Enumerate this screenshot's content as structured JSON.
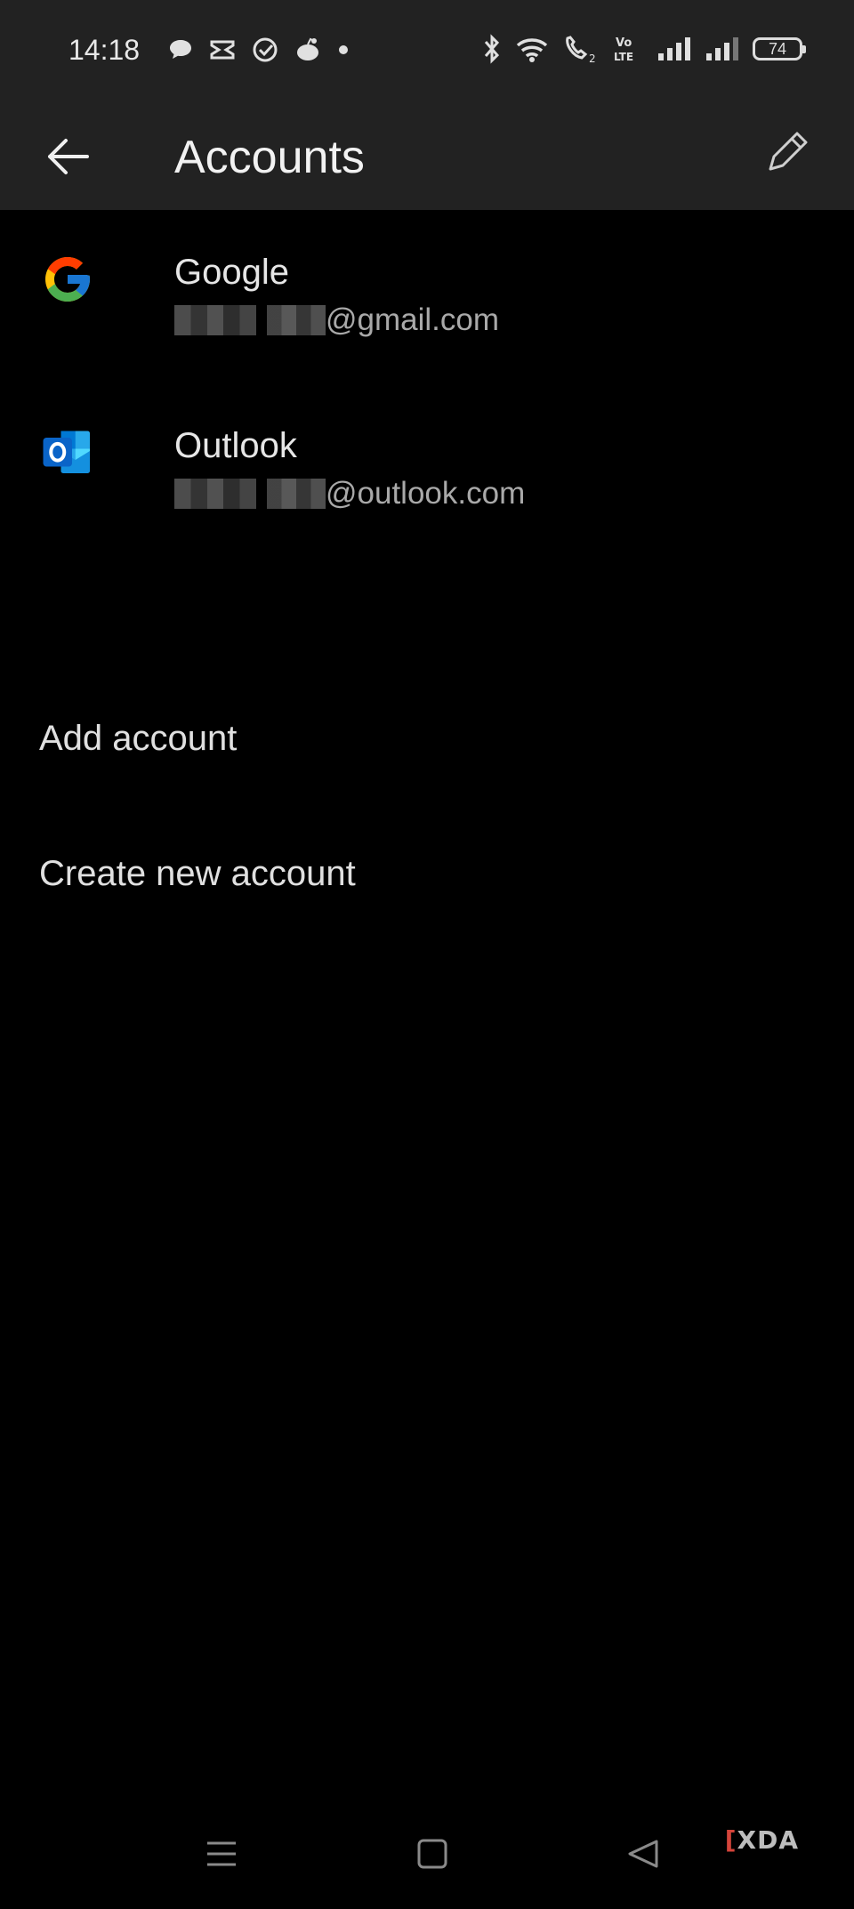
{
  "status_bar": {
    "time": "14:18",
    "battery": "74",
    "network_label": "Vo LTE"
  },
  "app_bar": {
    "title": "Accounts"
  },
  "accounts": [
    {
      "name": "Google",
      "email_domain": "@gmail.com"
    },
    {
      "name": "Outlook",
      "email_domain": "@outlook.com"
    }
  ],
  "menu": {
    "add_account": "Add account",
    "create_new_account": "Create new account"
  },
  "watermark": {
    "bracket": "[",
    "text": "XDA"
  },
  "colors": {
    "app_bar_bg": "#222222",
    "page_bg": "#000000",
    "outlook_blue": "#0a64c8"
  }
}
